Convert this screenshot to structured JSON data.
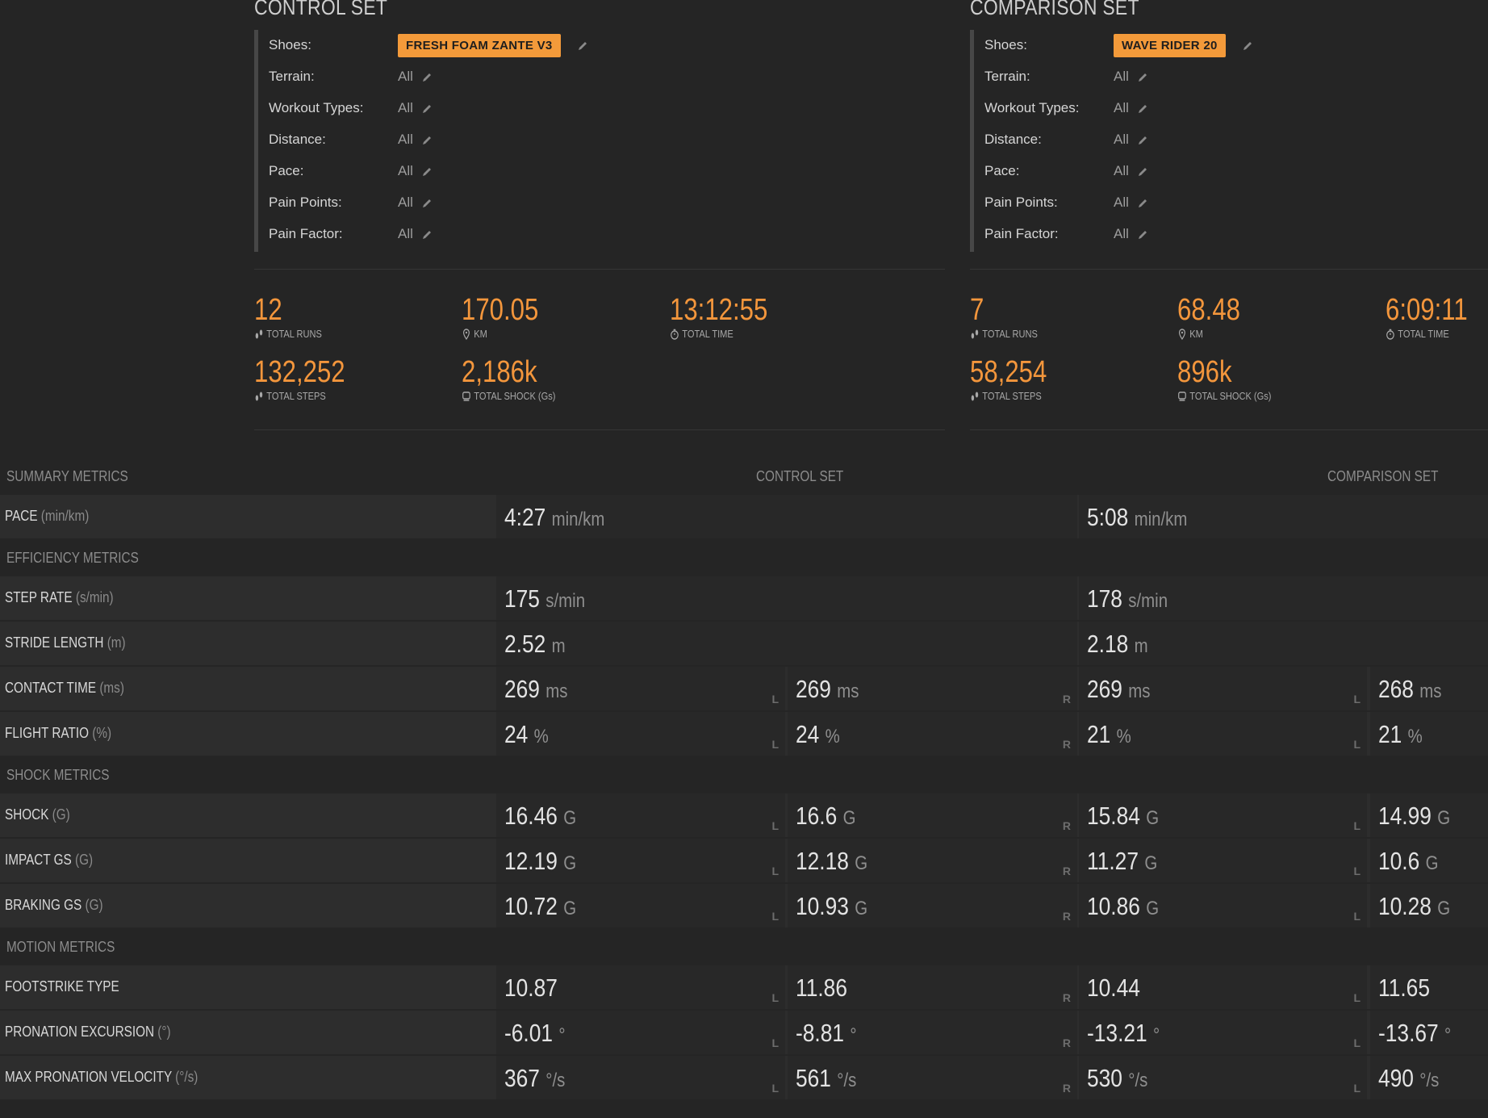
{
  "control": {
    "title": "CONTROL SET",
    "filters": [
      {
        "label": "Shoes:",
        "value": "FRESH FOAM ZANTE V3",
        "badge": true
      },
      {
        "label": "Terrain:",
        "value": "All"
      },
      {
        "label": "Workout Types:",
        "value": "All"
      },
      {
        "label": "Distance:",
        "value": "All"
      },
      {
        "label": "Pace:",
        "value": "All"
      },
      {
        "label": "Pain Points:",
        "value": "All"
      },
      {
        "label": "Pain Factor:",
        "value": "All"
      }
    ],
    "stats": {
      "runs": {
        "value": "12",
        "label": "TOTAL RUNS"
      },
      "km": {
        "value": "170.05",
        "label": "KM"
      },
      "time": {
        "value": "13:12:55",
        "label": "TOTAL TIME"
      },
      "steps": {
        "value": "132,252",
        "label": "TOTAL STEPS"
      },
      "shock": {
        "value": "2,186k",
        "label": "TOTAL SHOCK (Gs)"
      }
    }
  },
  "comparison": {
    "title": "COMPARISON SET",
    "filters": [
      {
        "label": "Shoes:",
        "value": "WAVE RIDER 20",
        "badge": true
      },
      {
        "label": "Terrain:",
        "value": "All"
      },
      {
        "label": "Workout Types:",
        "value": "All"
      },
      {
        "label": "Distance:",
        "value": "All"
      },
      {
        "label": "Pace:",
        "value": "All"
      },
      {
        "label": "Pain Points:",
        "value": "All"
      },
      {
        "label": "Pain Factor:",
        "value": "All"
      }
    ],
    "stats": {
      "runs": {
        "value": "7",
        "label": "TOTAL RUNS"
      },
      "km": {
        "value": "68.48",
        "label": "KM"
      },
      "time": {
        "value": "6:09:11",
        "label": "TOTAL TIME"
      },
      "steps": {
        "value": "58,254",
        "label": "TOTAL STEPS"
      },
      "shock": {
        "value": "896k",
        "label": "TOTAL SHOCK (Gs)"
      }
    }
  },
  "table": {
    "col_control": "CONTROL SET",
    "col_comparison": "COMPARISON SET",
    "side_left": "L",
    "side_right": "R",
    "sections": [
      {
        "title": "SUMMARY METRICS",
        "rows": [
          {
            "name": "PACE",
            "unit": "(min/km)",
            "split": false,
            "values": [
              [
                "4:27",
                "min/km"
              ],
              [
                "5:08",
                "min/km"
              ]
            ]
          }
        ]
      },
      {
        "title": "EFFICIENCY METRICS",
        "rows": [
          {
            "name": "STEP RATE",
            "unit": "(s/min)",
            "split": false,
            "values": [
              [
                "175",
                "s/min"
              ],
              [
                "178",
                "s/min"
              ]
            ]
          },
          {
            "name": "STRIDE LENGTH",
            "unit": "(m)",
            "split": false,
            "values": [
              [
                "2.52",
                "m"
              ],
              [
                "2.18",
                "m"
              ]
            ]
          },
          {
            "name": "CONTACT TIME",
            "unit": "(ms)",
            "split": true,
            "values": [
              [
                "269",
                "ms"
              ],
              [
                "269",
                "ms"
              ],
              [
                "269",
                "ms"
              ],
              [
                "268",
                "ms"
              ]
            ]
          },
          {
            "name": "FLIGHT RATIO",
            "unit": "(%)",
            "split": true,
            "values": [
              [
                "24",
                "%"
              ],
              [
                "24",
                "%"
              ],
              [
                "21",
                "%"
              ],
              [
                "21",
                "%"
              ]
            ]
          }
        ]
      },
      {
        "title": "SHOCK METRICS",
        "rows": [
          {
            "name": "SHOCK",
            "unit": "(G)",
            "split": true,
            "values": [
              [
                "16.46",
                "G"
              ],
              [
                "16.6",
                "G"
              ],
              [
                "15.84",
                "G"
              ],
              [
                "14.99",
                "G"
              ]
            ]
          },
          {
            "name": "IMPACT GS",
            "unit": "(G)",
            "split": true,
            "values": [
              [
                "12.19",
                "G"
              ],
              [
                "12.18",
                "G"
              ],
              [
                "11.27",
                "G"
              ],
              [
                "10.6",
                "G"
              ]
            ]
          },
          {
            "name": "BRAKING GS",
            "unit": "(G)",
            "split": true,
            "values": [
              [
                "10.72",
                "G"
              ],
              [
                "10.93",
                "G"
              ],
              [
                "10.86",
                "G"
              ],
              [
                "10.28",
                "G"
              ]
            ]
          }
        ]
      },
      {
        "title": "MOTION METRICS",
        "rows": [
          {
            "name": "FOOTSTRIKE TYPE",
            "unit": "",
            "split": true,
            "values": [
              [
                "10.87",
                ""
              ],
              [
                "11.86",
                ""
              ],
              [
                "10.44",
                ""
              ],
              [
                "11.65",
                ""
              ]
            ]
          },
          {
            "name": "PRONATION EXCURSION",
            "unit": "(°)",
            "split": true,
            "values": [
              [
                "-6.01",
                "°"
              ],
              [
                "-8.81",
                "°"
              ],
              [
                "-13.21",
                "°"
              ],
              [
                "-13.67",
                "°"
              ]
            ]
          },
          {
            "name": "MAX PRONATION VELOCITY",
            "unit": "(°/s)",
            "split": true,
            "values": [
              [
                "367",
                "°/s"
              ],
              [
                "561",
                "°/s"
              ],
              [
                "530",
                "°/s"
              ],
              [
                "490",
                "°/s"
              ]
            ]
          }
        ]
      }
    ]
  }
}
